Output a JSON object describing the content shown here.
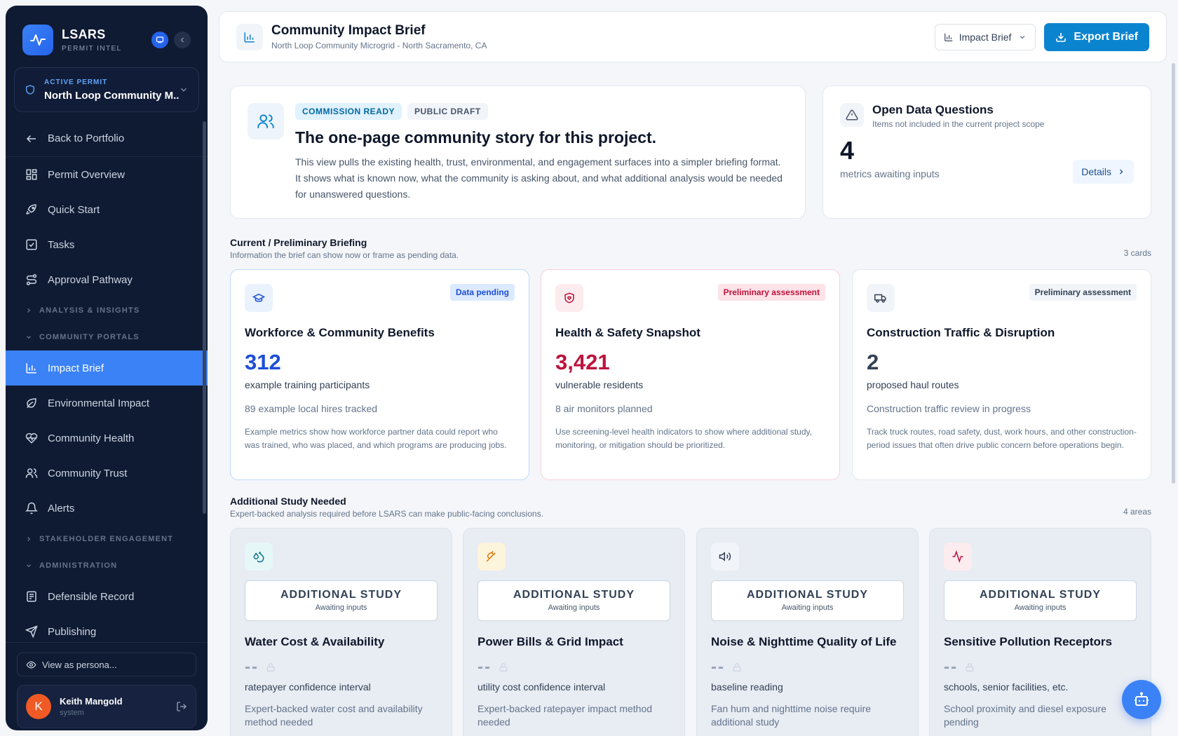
{
  "sidebar": {
    "brand": "LSARS",
    "brand_sub": "PERMIT INTEL",
    "permit_label": "ACTIVE PERMIT",
    "permit_value": "North Loop Community M...",
    "back": "Back to Portfolio",
    "items": [
      "Permit Overview",
      "Quick Start",
      "Tasks",
      "Approval Pathway"
    ],
    "sec_analysis": "ANALYSIS & INSIGHTS",
    "sec_portals": "COMMUNITY PORTALS",
    "portal_items": [
      "Impact Brief",
      "Environmental Impact",
      "Community Health",
      "Community Trust",
      "Alerts"
    ],
    "sec_stakeholder": "STAKEHOLDER ENGAGEMENT",
    "sec_admin": "ADMINISTRATION",
    "admin_items": [
      "Defensible Record",
      "Publishing"
    ],
    "persona": "View as persona...",
    "user_initial": "K",
    "user_name": "Keith Mangold",
    "user_role": "system"
  },
  "header": {
    "title": "Community Impact Brief",
    "subtitle": "North Loop Community Microgrid - North Sacramento, CA",
    "select_value": "Impact Brief",
    "export_label": "Export Brief"
  },
  "hero": {
    "pill_ready": "COMMISSION READY",
    "pill_draft": "PUBLIC DRAFT",
    "title": "The one-page community story for this project.",
    "body": "This view pulls the existing health, trust, environmental, and engagement surfaces into a simpler briefing format. It shows what is known now, what the community is asking about, and what additional analysis would be needed for unanswered questions."
  },
  "odq": {
    "title": "Open Data Questions",
    "subtitle": "Items not included in the current project scope",
    "number": "4",
    "caption": "metrics awaiting inputs",
    "details": "Details"
  },
  "briefing": {
    "title": "Current / Preliminary Briefing",
    "subtitle": "Information the brief can show now or frame as pending data.",
    "count": "3 cards",
    "cards": [
      {
        "badge": "Data pending",
        "title": "Workforce & Community Benefits",
        "big": "312",
        "cap": "example training participants",
        "sub": "89 example local hires tracked",
        "desc": "Example metrics show how workforce partner data could report who was trained, who was placed, and which programs are producing jobs.",
        "color": "#1d4ed8"
      },
      {
        "badge": "Preliminary assessment",
        "title": "Health & Safety Snapshot",
        "big": "3,421",
        "cap": "vulnerable residents",
        "sub": "8 air monitors planned",
        "desc": "Use screening-level health indicators to show where additional study, monitoring, or mitigation should be prioritized.",
        "color": "#be123c"
      },
      {
        "badge": "Preliminary assessment",
        "title": "Construction Traffic & Disruption",
        "big": "2",
        "cap": "proposed haul routes",
        "sub": "Construction traffic review in progress",
        "desc": "Track truck routes, road safety, dust, work hours, and other construction-period issues that often drive public concern before operations begin.",
        "color": "#334155"
      }
    ]
  },
  "study": {
    "title": "Additional Study Needed",
    "subtitle": "Expert-backed analysis required before LSARS can make public-facing conclusions.",
    "count": "4 areas",
    "banner": "ADDITIONAL STUDY",
    "banner_sub": "Awaiting inputs",
    "dash": "--",
    "cards": [
      {
        "title": "Water Cost & Availability",
        "cap": "ratepayer confidence interval",
        "desc": "Expert-backed water cost and availability method needed"
      },
      {
        "title": "Power Bills & Grid Impact",
        "cap": "utility cost confidence interval",
        "desc": "Expert-backed ratepayer impact method needed"
      },
      {
        "title": "Noise & Nighttime Quality of Life",
        "cap": "baseline reading",
        "desc": "Fan hum and nighttime noise require additional study"
      },
      {
        "title": "Sensitive Pollution Receptors",
        "cap": "schools, senior facilities, etc.",
        "desc": "School proximity and diesel exposure pending"
      }
    ]
  },
  "icons": {
    "logo": "pulse-icon",
    "accent": "#3b82f6",
    "export_bg": "#0b84d0"
  }
}
